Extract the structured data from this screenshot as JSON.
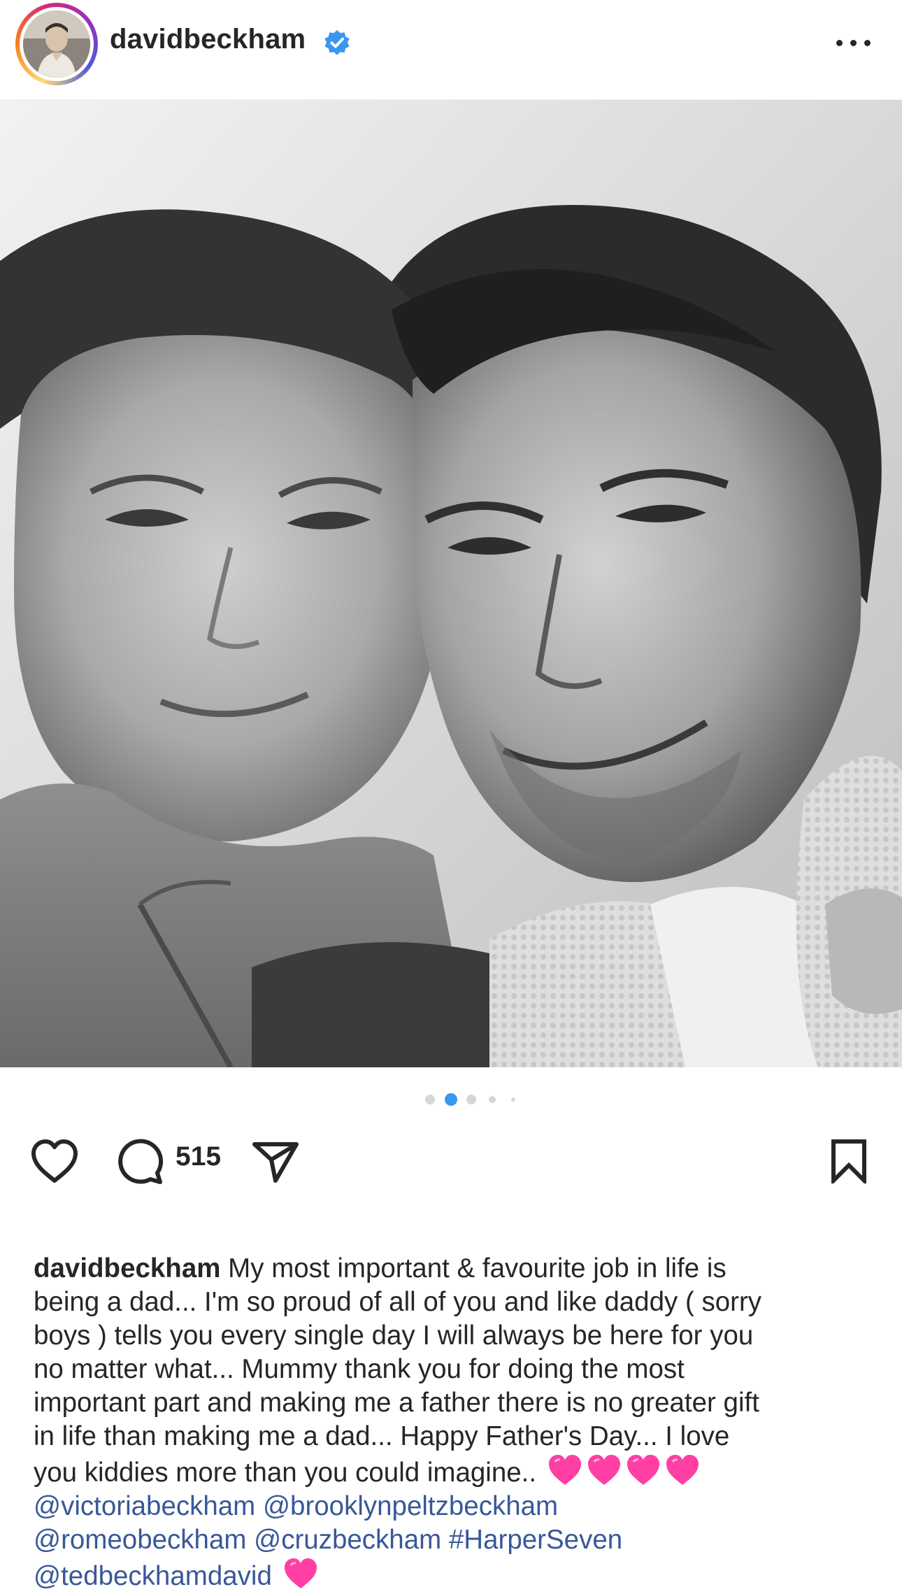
{
  "header": {
    "username": "davidbeckham",
    "verified": true,
    "more_icon": "more-horizontal-icon"
  },
  "photo": {
    "style": "black-and-white"
  },
  "carousel": {
    "dot_count": 5,
    "active_index": 1,
    "active_color": "#3897f0"
  },
  "actions": {
    "like_icon": "heart-outline-icon",
    "comment_icon": "comment-icon",
    "comment_count": "515",
    "share_icon": "send-icon",
    "save_icon": "bookmark-icon"
  },
  "caption": {
    "username": "davidbeckham",
    "lines": [
      " My most important & favourite job in life is",
      "being a dad... I'm so proud of all of you and like daddy ( sorry",
      "boys )  tells you every single day I will always be here for you",
      "no matter what... Mummy thank you for doing the most",
      "important part and making me a father there is no greater gift",
      "in life than making me a dad... Happy Father's Day... I love",
      "you kiddies more than you could imagine.. "
    ],
    "heart_emoji": "💗",
    "mentions": {
      "victoria": "@victoriabeckham",
      "brooklyn": "@brooklynpeltzbeckham",
      "romeo": "@romeobeckham",
      "cruz": "@cruzbeckham",
      "hashtag": "#HarperSeven",
      "ted": "@tedbeckhamdavid"
    },
    "link_color": "#385898"
  },
  "colors": {
    "text": "#262626",
    "verified_blue": "#3897f0",
    "heart_pink": "#ff3fa4"
  }
}
